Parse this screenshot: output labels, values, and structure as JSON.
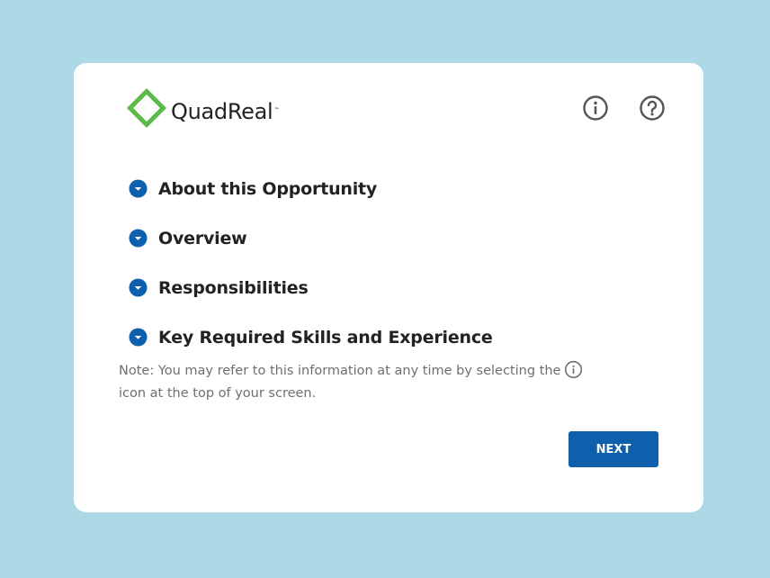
{
  "brand": {
    "name": "QuadReal",
    "trademark": "™"
  },
  "header": {
    "info_icon": "info-circle-icon",
    "help_icon": "question-circle-icon"
  },
  "sections": [
    {
      "label": "About this Opportunity",
      "icon": "chevron-down-circle-icon"
    },
    {
      "label": "Overview",
      "icon": "chevron-down-circle-icon"
    },
    {
      "label": "Responsibilities",
      "icon": "chevron-down-circle-icon"
    },
    {
      "label": "Key Required Skills and Experience",
      "icon": "chevron-down-circle-icon"
    }
  ],
  "note": {
    "text_before": "Note: You may refer to this information at any time by selecting the",
    "text_after": "icon at the top of your screen."
  },
  "actions": {
    "next_label": "NEXT"
  },
  "colors": {
    "background": "#add8e6",
    "card": "#ffffff",
    "accent": "#0f60ac",
    "text": "#222222",
    "muted": "#6f6f6f",
    "icon": "#555555"
  }
}
